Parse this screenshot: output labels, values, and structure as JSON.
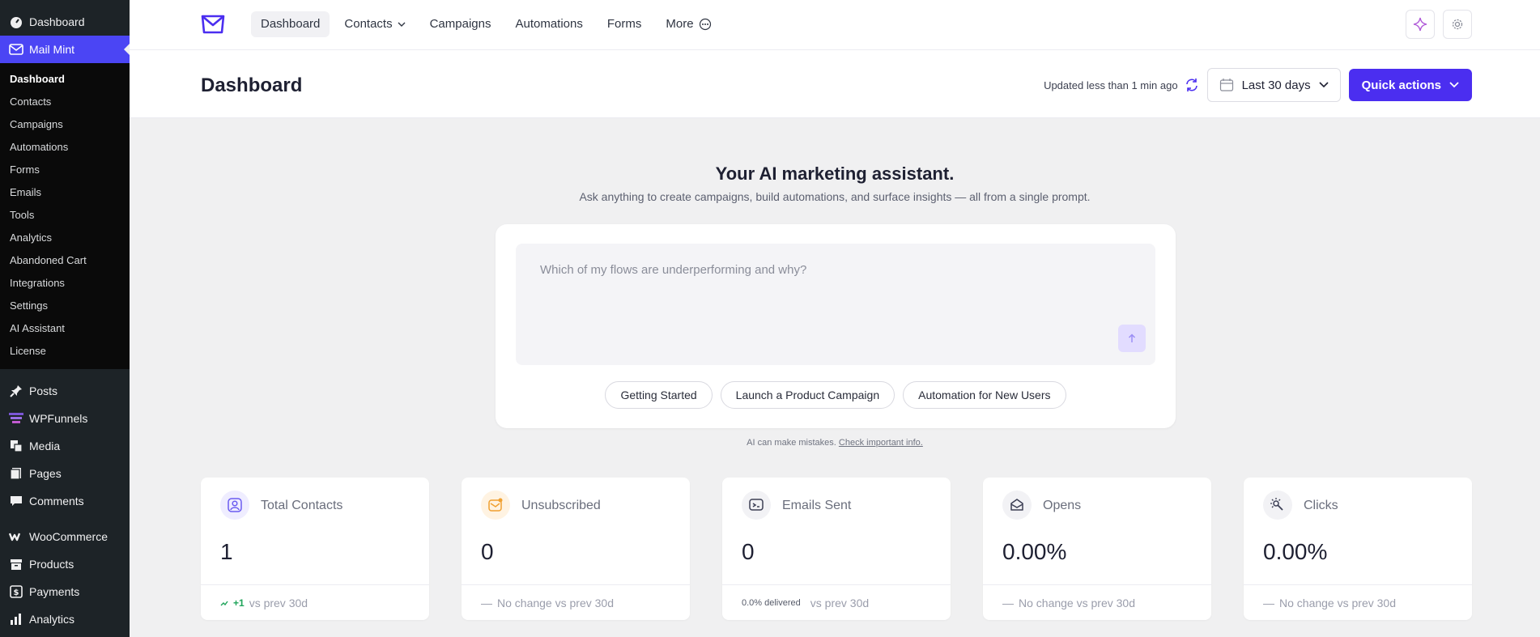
{
  "sidebar": {
    "top": [
      {
        "label": "Dashboard",
        "icon": "dashboard-icon"
      },
      {
        "label": "Mail Mint",
        "icon": "mail-icon"
      }
    ],
    "submenu": [
      "Dashboard",
      "Contacts",
      "Campaigns",
      "Automations",
      "Forms",
      "Emails",
      "Tools",
      "Analytics",
      "Abandoned Cart",
      "Integrations",
      "Settings",
      "AI Assistant",
      "License"
    ],
    "bottom": [
      {
        "label": "Posts",
        "icon": "pin-icon"
      },
      {
        "label": "WPFunnels",
        "icon": "funnel-icon"
      },
      {
        "label": "Media",
        "icon": "media-icon"
      },
      {
        "label": "Pages",
        "icon": "pages-icon"
      },
      {
        "label": "Comments",
        "icon": "comment-icon"
      }
    ],
    "bottom2": [
      {
        "label": "WooCommerce",
        "icon": "woo-icon"
      },
      {
        "label": "Products",
        "icon": "box-icon"
      },
      {
        "label": "Payments",
        "icon": "dollar-icon"
      },
      {
        "label": "Analytics",
        "icon": "bar-chart-icon"
      }
    ]
  },
  "topnav": {
    "links": [
      "Dashboard",
      "Contacts",
      "Campaigns",
      "Automations",
      "Forms",
      "More"
    ]
  },
  "header": {
    "title": "Dashboard",
    "updated": "Updated less than 1 min ago",
    "date_range": "Last 30 days",
    "quick_actions": "Quick actions"
  },
  "ai": {
    "title": "Your AI marketing assistant.",
    "subtitle": "Ask anything to create campaigns, build automations, and surface insights — all from a single prompt.",
    "placeholder": "Which of my flows are underperforming and why?",
    "chips": [
      "Getting Started",
      "Launch a Product Campaign",
      "Automation for New Users"
    ],
    "disclaimer": "AI can make mistakes.",
    "disclaimer_link": "Check important info."
  },
  "stats": [
    {
      "label": "Total Contacts",
      "value": "1",
      "change": "+1",
      "foot": "vs prev 30d",
      "icon": "contact-icon",
      "color": "#7c6cf3"
    },
    {
      "label": "Unsubscribed",
      "value": "0",
      "change": "—",
      "foot": "No change vs prev 30d",
      "icon": "unsubscribe-icon",
      "color": "#f0a030"
    },
    {
      "label": "Emails Sent",
      "value": "0",
      "change": "0.0% delivered",
      "foot": "vs prev 30d",
      "icon": "sent-icon",
      "color": "#3c3f55"
    },
    {
      "label": "Opens",
      "value": "0.00%",
      "change": "—",
      "foot": "No change vs prev 30d",
      "icon": "open-icon",
      "color": "#3c3f55"
    },
    {
      "label": "Clicks",
      "value": "0.00%",
      "change": "—",
      "foot": "No change vs prev 30d",
      "icon": "click-icon",
      "color": "#3c3f55"
    }
  ],
  "colors": {
    "accent": "#4b2ef0",
    "sidebar_bg": "#1d2327",
    "sidebar_current": "#4b45f4"
  }
}
